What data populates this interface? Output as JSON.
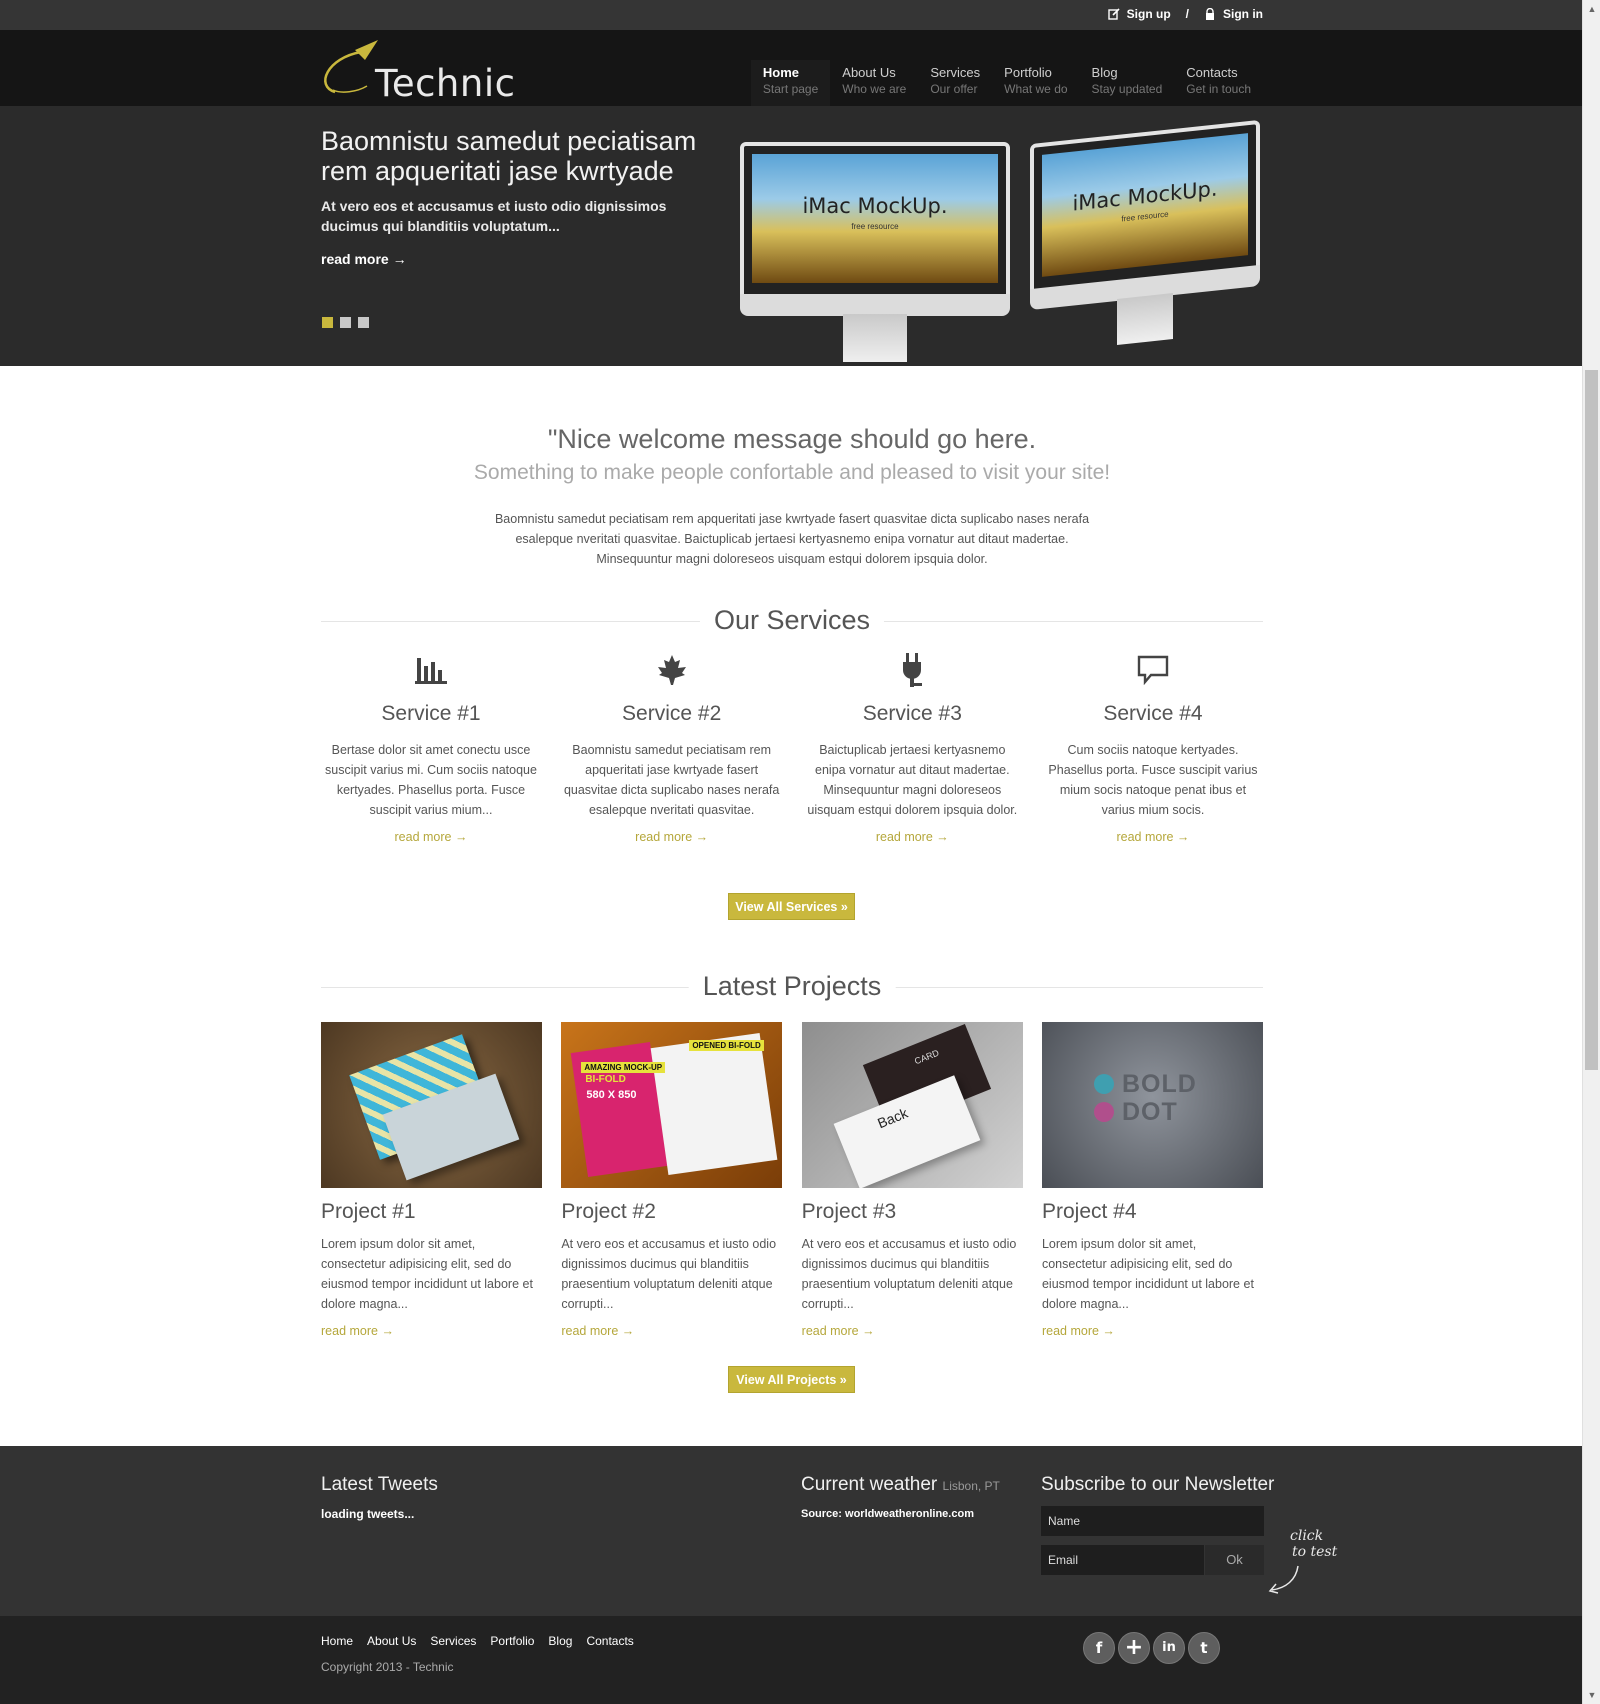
{
  "topbar": {
    "signup": "Sign up",
    "separator": "/",
    "signin": "Sign in"
  },
  "brand": {
    "name": "Technic",
    "accent": "#c9b83d"
  },
  "nav": [
    {
      "title": "Home",
      "subtitle": "Start page"
    },
    {
      "title": "About Us",
      "subtitle": "Who we are"
    },
    {
      "title": "Services",
      "subtitle": "Our offer"
    },
    {
      "title": "Portfolio",
      "subtitle": "What we do"
    },
    {
      "title": "Blog",
      "subtitle": "Stay updated"
    },
    {
      "title": "Contacts",
      "subtitle": "Get in touch"
    }
  ],
  "hero": {
    "title": "Baomnistu samedut peciatisam rem apqueritati jase kwrtyade",
    "lead": "At vero eos et accusamus et iusto odio dignissimos ducimus qui blanditiis voluptatum...",
    "read_more": "read more →",
    "slides": 3,
    "active_slide": 1,
    "mock_label": "iMac MockUp.",
    "mock_sub": "free resource"
  },
  "welcome": {
    "quote": "\"Nice welcome message should go here.",
    "subtitle": "Something to make people confortable and pleased to visit your site!",
    "text": "Baomnistu samedut peciatisam rem apqueritati jase kwrtyade fasert quasvitae dicta suplicabo nases nerafa esalepque nveritati quasvitae. Baictuplicab jertaesi kertyasnemo enipa vornatur aut ditaut madertae. Minsequuntur magni doloreseos uisquam estqui dolorem ipsquia dolor."
  },
  "services": {
    "heading": "Our Services",
    "items": [
      {
        "icon": "bar-chart-icon",
        "title": "Service #1",
        "text": "Bertase dolor sit amet conectu usce suscipit varius mi. Cum sociis natoque kertyades. Phasellus porta. Fusce suscipit varius mium...",
        "more": "read more →"
      },
      {
        "icon": "maple-leaf-icon",
        "title": "Service #2",
        "text": "Baomnistu samedut peciatisam rem apqueritati jase kwrtyade fasert quasvitae dicta suplicabo nases nerafa esalepque nveritati quasvitae.",
        "more": "read more →"
      },
      {
        "icon": "plug-icon",
        "title": "Service #3",
        "text": "Baictuplicab jertaesi kertyasnemo enipa vornatur aut ditaut madertae. Minsequuntur magni doloreseos uisquam estqui dolorem ipsquia dolor.",
        "more": "read more →"
      },
      {
        "icon": "speech-bubble-icon",
        "title": "Service #4",
        "text": "Cum sociis natoque kertyades. Phasellus porta. Fusce suscipit varius mium socis natoque penat ibus et varius mium socis.",
        "more": "read more →"
      }
    ],
    "button": "View All Services »"
  },
  "projects": {
    "heading": "Latest Projects",
    "items": [
      {
        "title": "Project #1",
        "text": "Lorem ipsum dolor sit amet, consectetur adipisicing elit, sed do eiusmod tempor incididunt ut labore et dolore magna...",
        "more": "read more →"
      },
      {
        "title": "Project #2",
        "text": "At vero eos et accusamus et iusto odio dignissimos ducimus qui blanditiis praesentium voluptatum deleniti atque corrupti...",
        "more": "read more →",
        "img_text_1": "AMAZING MOCK-UP",
        "img_text_2": "BI-FOLD",
        "img_text_3": "580 X 850",
        "img_text_4": "OPENED BI-FOLD"
      },
      {
        "title": "Project #3",
        "text": "At vero eos et accusamus et iusto odio dignissimos ducimus qui blanditiis praesentium voluptatum deleniti atque corrupti...",
        "more": "read more →",
        "img_text_1": "Back",
        "img_text_2": "CARD"
      },
      {
        "title": "Project #4",
        "text": "Lorem ipsum dolor sit amet, consectetur adipisicing elit, sed do eiusmod tempor incididunt ut labore et dolore magna...",
        "more": "read more →",
        "img_text_1": "BOLD",
        "img_text_2": "DOT"
      }
    ],
    "button": "View All Projects »"
  },
  "footer": {
    "tweets_title": "Latest Tweets",
    "tweets_status": "loading tweets...",
    "weather_title": "Current weather",
    "weather_location": "Lisbon, PT",
    "weather_source": "Source: worldweatheronline.com",
    "newsletter_title": "Subscribe to our Newsletter",
    "name_placeholder": "Name",
    "email_placeholder": "Email",
    "ok": "Ok",
    "note_1": "click",
    "note_2": "to test"
  },
  "bottom": {
    "links": [
      "Home",
      "About Us",
      "Services",
      "Portfolio",
      "Blog",
      "Contacts"
    ],
    "copyright": "Copyright 2013 - Technic",
    "social": [
      {
        "name": "facebook-icon",
        "glyph": "f"
      },
      {
        "name": "google-plus-icon",
        "glyph": "+"
      },
      {
        "name": "linkedin-icon",
        "glyph": "in"
      },
      {
        "name": "twitter-icon",
        "glyph": "t"
      }
    ]
  }
}
